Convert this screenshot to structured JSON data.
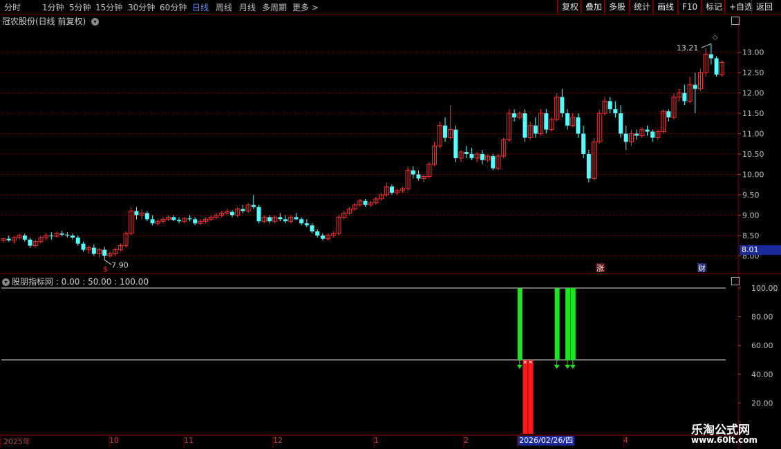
{
  "toolbar": {
    "periods": [
      "分时",
      "1分钟",
      "5分钟",
      "15分钟",
      "30分钟",
      "60分钟",
      "日线",
      "周线",
      "月线",
      "多周期",
      "更多 >"
    ],
    "active_period": "日线",
    "tools": [
      "复权",
      "叠加",
      "多股",
      "统计",
      "画线",
      "F10",
      "标记",
      "+自选",
      "返回"
    ]
  },
  "main_chart": {
    "title": "冠农股份(日线 前复权)",
    "high_label": "13.21",
    "low_label": "7.90",
    "current_price": "8.01",
    "event_markers": [
      "$",
      "涨",
      "财"
    ],
    "y_ticks": [
      "13.00",
      "12.50",
      "12.00",
      "11.50",
      "11.00",
      "10.50",
      "10.00",
      "9.50",
      "9.00",
      "8.50",
      "8.00"
    ]
  },
  "indicator": {
    "title": "股朋指标网 : 0.00 : 50.00 : 100.00",
    "y_ticks": [
      "100.00",
      "80.00",
      "60.00",
      "40.00",
      "20.00"
    ]
  },
  "x_axis": {
    "labels": [
      "2025年",
      "10",
      "11",
      "12",
      "1",
      "2",
      "4"
    ],
    "cursor_date": "2026/02/26/四"
  },
  "watermark": {
    "line1": "乐淘公式网",
    "line2": "www.60lt.com"
  },
  "colors": {
    "up": "#ff3232",
    "down": "#54ffff",
    "grid": "#8b0000",
    "buy": "#ff1a1a",
    "sell": "#1ee61e"
  },
  "chart_data": {
    "type": "candlestick",
    "ylim": [
      7.6,
      13.4
    ],
    "candles": [
      [
        8.38,
        8.45,
        8.32,
        8.42
      ],
      [
        8.42,
        8.5,
        8.35,
        8.38
      ],
      [
        8.38,
        8.48,
        8.3,
        8.45
      ],
      [
        8.45,
        8.55,
        8.4,
        8.5
      ],
      [
        8.5,
        8.55,
        8.35,
        8.4
      ],
      [
        8.4,
        8.45,
        8.2,
        8.25
      ],
      [
        8.25,
        8.4,
        8.2,
        8.35
      ],
      [
        8.35,
        8.48,
        8.3,
        8.45
      ],
      [
        8.45,
        8.55,
        8.38,
        8.5
      ],
      [
        8.5,
        8.58,
        8.4,
        8.48
      ],
      [
        8.48,
        8.6,
        8.45,
        8.55
      ],
      [
        8.55,
        8.62,
        8.48,
        8.52
      ],
      [
        8.52,
        8.58,
        8.45,
        8.5
      ],
      [
        8.5,
        8.55,
        8.4,
        8.45
      ],
      [
        8.45,
        8.5,
        8.25,
        8.3
      ],
      [
        8.3,
        8.35,
        8.1,
        8.15
      ],
      [
        8.15,
        8.25,
        8.05,
        8.2
      ],
      [
        8.2,
        8.28,
        8.0,
        8.05
      ],
      [
        8.05,
        8.2,
        7.95,
        8.15
      ],
      [
        8.15,
        8.22,
        7.9,
        8.0
      ],
      [
        8.0,
        8.1,
        7.95,
        8.05
      ],
      [
        8.05,
        8.2,
        8.0,
        8.15
      ],
      [
        8.15,
        8.3,
        8.1,
        8.25
      ],
      [
        8.25,
        8.6,
        8.2,
        8.55
      ],
      [
        8.55,
        9.2,
        8.5,
        9.1
      ],
      [
        9.1,
        9.2,
        8.9,
        9.0
      ],
      [
        9.0,
        9.15,
        8.9,
        9.05
      ],
      [
        9.05,
        9.1,
        8.85,
        8.9
      ],
      [
        8.9,
        9.0,
        8.75,
        8.8
      ],
      [
        8.8,
        8.9,
        8.75,
        8.85
      ],
      [
        8.85,
        8.95,
        8.8,
        8.9
      ],
      [
        8.9,
        9.0,
        8.85,
        8.95
      ],
      [
        8.95,
        9.0,
        8.85,
        8.88
      ],
      [
        8.88,
        8.95,
        8.8,
        8.85
      ],
      [
        8.85,
        8.95,
        8.8,
        8.92
      ],
      [
        8.92,
        9.0,
        8.85,
        8.9
      ],
      [
        8.9,
        8.95,
        8.75,
        8.8
      ],
      [
        8.8,
        8.9,
        8.75,
        8.85
      ],
      [
        8.85,
        8.95,
        8.8,
        8.9
      ],
      [
        8.9,
        9.0,
        8.85,
        8.95
      ],
      [
        8.95,
        9.05,
        8.9,
        9.0
      ],
      [
        9.0,
        9.1,
        8.95,
        9.05
      ],
      [
        9.05,
        9.15,
        9.0,
        9.08
      ],
      [
        9.08,
        9.12,
        8.95,
        9.0
      ],
      [
        9.0,
        9.2,
        8.95,
        9.15
      ],
      [
        9.15,
        9.25,
        9.05,
        9.1
      ],
      [
        9.1,
        9.3,
        9.05,
        9.25
      ],
      [
        9.25,
        9.5,
        9.15,
        9.2
      ],
      [
        9.2,
        9.25,
        8.8,
        8.85
      ],
      [
        8.85,
        9.0,
        8.8,
        8.95
      ],
      [
        8.95,
        9.0,
        8.8,
        8.85
      ],
      [
        8.85,
        9.0,
        8.8,
        8.95
      ],
      [
        8.95,
        9.05,
        8.85,
        8.9
      ],
      [
        8.9,
        9.0,
        8.8,
        8.85
      ],
      [
        8.85,
        9.0,
        8.8,
        8.95
      ],
      [
        8.95,
        9.05,
        8.88,
        8.9
      ],
      [
        8.9,
        8.95,
        8.75,
        8.8
      ],
      [
        8.8,
        8.9,
        8.7,
        8.75
      ],
      [
        8.75,
        8.8,
        8.55,
        8.6
      ],
      [
        8.6,
        8.65,
        8.45,
        8.5
      ],
      [
        8.5,
        8.55,
        8.38,
        8.42
      ],
      [
        8.42,
        8.55,
        8.38,
        8.5
      ],
      [
        8.5,
        8.6,
        8.45,
        8.55
      ],
      [
        8.55,
        9.0,
        8.5,
        8.95
      ],
      [
        8.95,
        9.1,
        8.9,
        9.05
      ],
      [
        9.05,
        9.2,
        9.0,
        9.15
      ],
      [
        9.15,
        9.3,
        9.1,
        9.25
      ],
      [
        9.25,
        9.4,
        9.2,
        9.35
      ],
      [
        9.35,
        9.4,
        9.2,
        9.25
      ],
      [
        9.25,
        9.35,
        9.2,
        9.3
      ],
      [
        9.3,
        9.45,
        9.25,
        9.4
      ],
      [
        9.4,
        9.55,
        9.35,
        9.5
      ],
      [
        9.5,
        9.8,
        9.45,
        9.7
      ],
      [
        9.7,
        9.75,
        9.5,
        9.55
      ],
      [
        9.55,
        9.65,
        9.5,
        9.6
      ],
      [
        9.6,
        9.7,
        9.55,
        9.65
      ],
      [
        9.65,
        10.2,
        9.6,
        10.1
      ],
      [
        10.1,
        10.2,
        9.9,
        10.0
      ],
      [
        10.0,
        10.1,
        9.85,
        9.9
      ],
      [
        9.9,
        10.0,
        9.8,
        9.95
      ],
      [
        9.95,
        10.3,
        9.9,
        10.25
      ],
      [
        10.25,
        10.8,
        10.2,
        10.7
      ],
      [
        10.7,
        11.3,
        10.65,
        11.2
      ],
      [
        11.2,
        11.4,
        10.8,
        10.9
      ],
      [
        10.9,
        11.7,
        10.85,
        11.1
      ],
      [
        11.1,
        11.2,
        10.3,
        10.4
      ],
      [
        10.4,
        10.6,
        10.3,
        10.55
      ],
      [
        10.55,
        10.7,
        10.4,
        10.5
      ],
      [
        10.5,
        10.65,
        10.35,
        10.4
      ],
      [
        10.4,
        10.55,
        10.3,
        10.5
      ],
      [
        10.5,
        10.6,
        10.25,
        10.35
      ],
      [
        10.35,
        10.5,
        10.3,
        10.45
      ],
      [
        10.45,
        10.5,
        10.1,
        10.15
      ],
      [
        10.15,
        10.5,
        10.1,
        10.45
      ],
      [
        10.45,
        10.9,
        10.4,
        10.85
      ],
      [
        10.85,
        11.6,
        10.8,
        11.5
      ],
      [
        11.5,
        11.6,
        11.3,
        11.4
      ],
      [
        11.4,
        11.55,
        11.35,
        11.5
      ],
      [
        11.5,
        11.6,
        10.8,
        10.9
      ],
      [
        10.9,
        11.3,
        10.85,
        11.2
      ],
      [
        11.2,
        11.4,
        10.9,
        11.0
      ],
      [
        11.0,
        11.6,
        10.95,
        11.5
      ],
      [
        11.5,
        11.6,
        11.0,
        11.1
      ],
      [
        11.1,
        11.4,
        11.05,
        11.35
      ],
      [
        11.35,
        12.0,
        11.3,
        11.9
      ],
      [
        11.9,
        12.1,
        11.4,
        11.5
      ],
      [
        11.5,
        11.6,
        11.1,
        11.2
      ],
      [
        11.2,
        11.5,
        11.15,
        11.4
      ],
      [
        11.4,
        11.5,
        10.9,
        11.0
      ],
      [
        11.0,
        11.2,
        10.4,
        10.5
      ],
      [
        10.5,
        10.6,
        9.8,
        9.9
      ],
      [
        9.9,
        10.9,
        9.85,
        10.8
      ],
      [
        10.8,
        11.6,
        10.75,
        11.5
      ],
      [
        11.5,
        11.9,
        11.45,
        11.8
      ],
      [
        11.8,
        11.9,
        11.5,
        11.6
      ],
      [
        11.6,
        11.8,
        11.4,
        11.5
      ],
      [
        11.5,
        11.7,
        10.9,
        11.0
      ],
      [
        11.0,
        11.2,
        10.6,
        10.8
      ],
      [
        10.8,
        11.1,
        10.7,
        11.0
      ],
      [
        11.0,
        11.1,
        10.85,
        10.95
      ],
      [
        10.95,
        11.15,
        10.9,
        11.1
      ],
      [
        11.1,
        11.2,
        10.95,
        11.05
      ],
      [
        11.05,
        11.1,
        10.8,
        10.9
      ],
      [
        10.9,
        11.1,
        10.85,
        11.05
      ],
      [
        11.05,
        11.6,
        11.0,
        11.55
      ],
      [
        11.55,
        11.6,
        11.3,
        11.4
      ],
      [
        11.4,
        12.0,
        11.35,
        11.9
      ],
      [
        11.9,
        12.1,
        11.8,
        12.0
      ],
      [
        12.0,
        12.2,
        11.7,
        11.8
      ],
      [
        11.8,
        12.4,
        11.75,
        12.2
      ],
      [
        12.2,
        12.5,
        11.5,
        12.1
      ],
      [
        12.1,
        12.6,
        12.05,
        12.5
      ],
      [
        12.5,
        13.1,
        12.4,
        12.95
      ],
      [
        12.95,
        13.21,
        12.7,
        12.85
      ],
      [
        12.85,
        12.9,
        12.4,
        12.45
      ],
      [
        12.45,
        12.8,
        12.4,
        12.75
      ]
    ],
    "indicator_series": {
      "ylim": [
        0,
        110
      ],
      "reference_lines": [
        50,
        100
      ],
      "buy_bars_index": [
        98,
        99
      ],
      "sell_bars_index": [
        97,
        104,
        106,
        107
      ]
    }
  }
}
